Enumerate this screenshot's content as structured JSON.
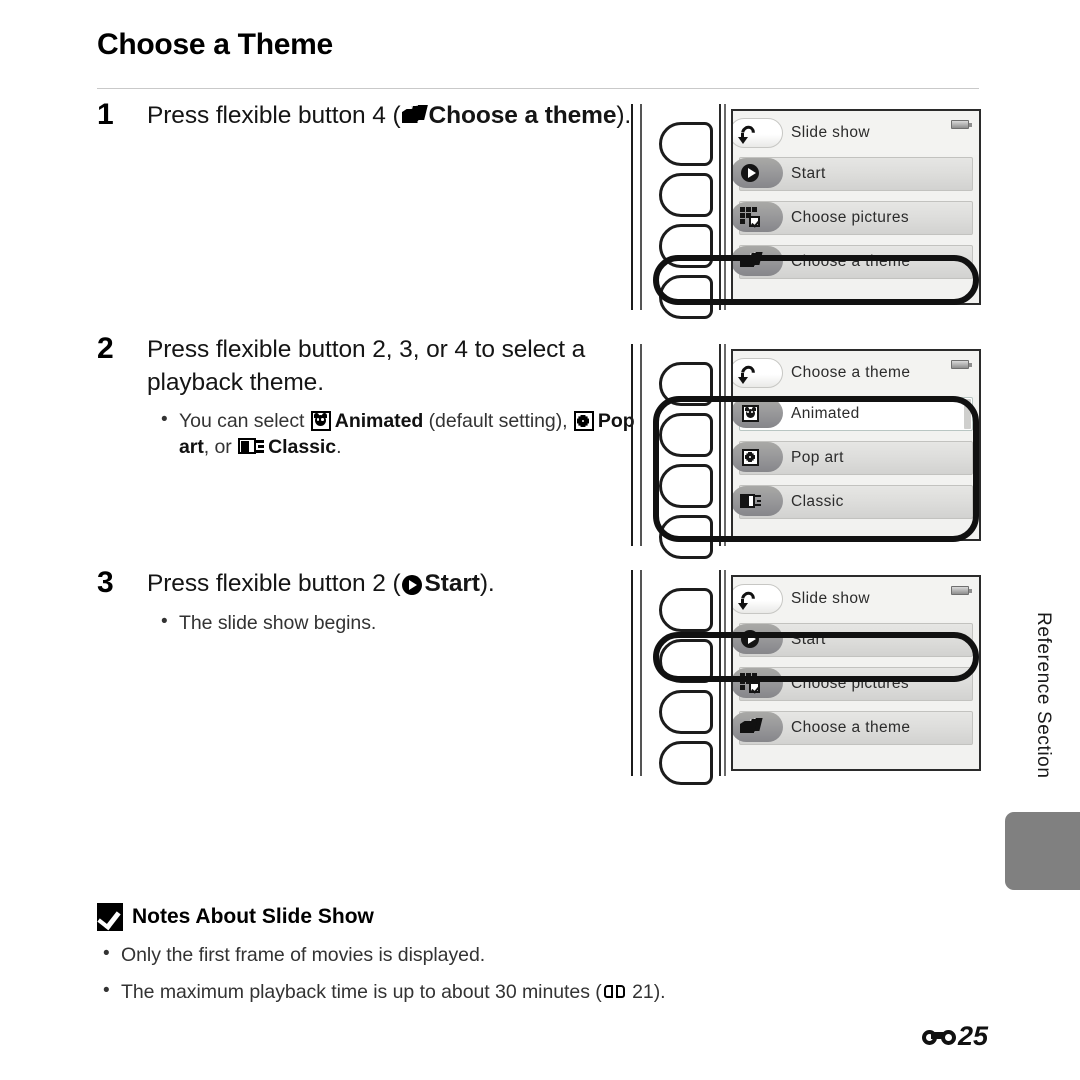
{
  "page": {
    "title": "Choose a Theme",
    "folio_number": "25",
    "side_tab_label": "Reference Section"
  },
  "steps": [
    {
      "number": "1",
      "head_pre": "Press flexible button 4 (",
      "head_icon": "theme-cards-icon",
      "head_bold": "Choose a theme",
      "head_post": ").",
      "bullets": []
    },
    {
      "number": "2",
      "head_pre": "Press flexible button 2, 3, or 4 to select a playback theme.",
      "head_icon": "",
      "head_bold": "",
      "head_post": "",
      "bullets": [
        {
          "pre": "You can select ",
          "icon1": "animated-icon",
          "bold1": "Animated",
          "mid1": " (default setting), ",
          "icon2": "popart-icon",
          "bold2": "Pop art",
          "mid2": ", or ",
          "icon3": "classic-icon",
          "bold3": "Classic",
          "post": "."
        }
      ]
    },
    {
      "number": "3",
      "head_pre": "Press flexible button 2 (",
      "head_icon": "play-icon",
      "head_bold": "Start",
      "head_post": ").",
      "bullets": [
        {
          "pre": "The slide show begins."
        }
      ]
    }
  ],
  "screens": [
    {
      "name": "slide-show-menu-theme-selected",
      "title": "Slide show",
      "title_icon": "back-arrow-icon",
      "battery_icon": "battery-icon",
      "rows": [
        {
          "label": "Start",
          "icon": "play-icon",
          "selected": false,
          "scrollbar": false
        },
        {
          "label": "Choose pictures",
          "icon": "grid-check-icon",
          "selected": false,
          "scrollbar": false
        },
        {
          "label": "Choose a theme",
          "icon": "theme-cards-icon",
          "selected": false,
          "scrollbar": false
        }
      ],
      "highlight_row_index": 2
    },
    {
      "name": "choose-a-theme-menu",
      "title": "Choose a theme",
      "title_icon": "back-arrow-icon",
      "battery_icon": "battery-icon",
      "rows": [
        {
          "label": "Animated",
          "icon": "animated-icon",
          "selected": true,
          "scrollbar": true
        },
        {
          "label": "Pop art",
          "icon": "popart-icon",
          "selected": false,
          "scrollbar": false
        },
        {
          "label": "Classic",
          "icon": "classic-icon",
          "selected": false,
          "scrollbar": false
        }
      ],
      "highlight_row_index": -1
    },
    {
      "name": "slide-show-menu-start-selected",
      "title": "Slide show",
      "title_icon": "back-arrow-icon",
      "battery_icon": "battery-icon",
      "rows": [
        {
          "label": "Start",
          "icon": "play-icon",
          "selected": false,
          "scrollbar": false
        },
        {
          "label": "Choose pictures",
          "icon": "grid-check-icon",
          "selected": false,
          "scrollbar": false
        },
        {
          "label": "Choose a theme",
          "icon": "theme-cards-icon",
          "selected": false,
          "scrollbar": false
        }
      ],
      "highlight_row_index": 0
    }
  ],
  "notes": {
    "icon": "caution-check-icon",
    "heading": "Notes About Slide Show",
    "items": [
      {
        "text": "Only the first frame of movies is displayed."
      },
      {
        "pre": "The maximum playback time is up to about 30 minutes (",
        "icon": "book-reference-icon",
        "post": " 21)."
      }
    ]
  }
}
